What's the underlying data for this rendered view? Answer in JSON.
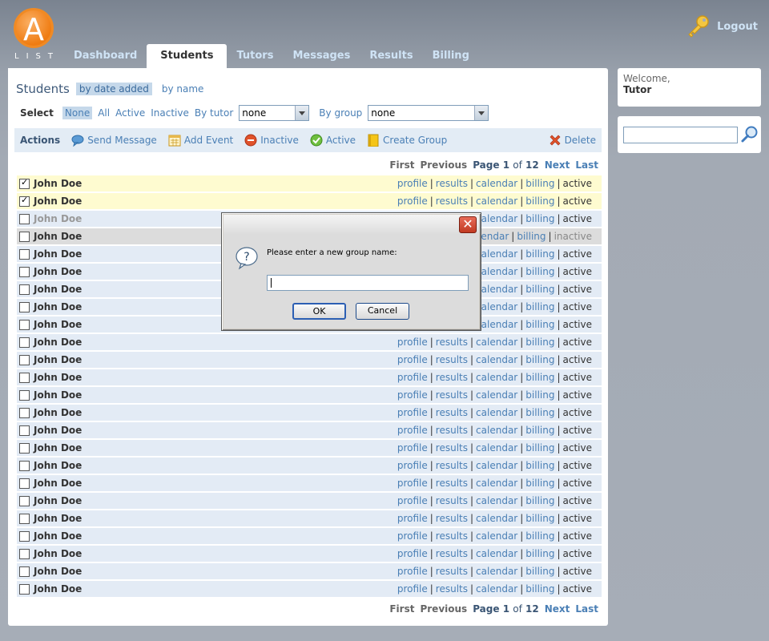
{
  "header": {
    "logo_letter": "A",
    "logo_text": "LIST",
    "logout_label": "Logout",
    "nav": [
      {
        "label": "Dashboard"
      },
      {
        "label": "Students"
      },
      {
        "label": "Tutors"
      },
      {
        "label": "Messages"
      },
      {
        "label": "Results"
      },
      {
        "label": "Billing"
      }
    ],
    "active_tab": "Students"
  },
  "main": {
    "title": "Students",
    "sort_active": "by date added",
    "sort_other": "by name",
    "select_label": "Select",
    "filters": [
      "None",
      "All",
      "Active",
      "Inactive"
    ],
    "by_tutor_label": "By tutor",
    "by_tutor_value": "none",
    "by_group_label": "By group",
    "by_group_value": "none",
    "actions_label": "Actions",
    "actions": {
      "send_message": "Send Message",
      "add_event": "Add Event",
      "inactive": "Inactive",
      "active": "Active",
      "create_group": "Create Group",
      "delete": "Delete"
    },
    "pager": {
      "first": "First",
      "previous": "Previous",
      "page_prefix": "Page",
      "page": "1",
      "of": "of",
      "total": "12",
      "next": "Next",
      "last": "Last"
    },
    "row_links": {
      "profile": "profile",
      "results": "results",
      "calendar": "calendar",
      "billing": "billing"
    },
    "students": [
      {
        "name": "John Doe",
        "checked": true,
        "status": "active",
        "dim": false
      },
      {
        "name": "John Doe",
        "checked": true,
        "status": "active",
        "dim": false
      },
      {
        "name": "John Doe",
        "checked": false,
        "status": "active",
        "dim": true
      },
      {
        "name": "John Doe",
        "checked": false,
        "status": "inactive",
        "dim": false
      },
      {
        "name": "John Doe",
        "checked": false,
        "status": "active",
        "dim": false
      },
      {
        "name": "John Doe",
        "checked": false,
        "status": "active",
        "dim": false
      },
      {
        "name": "John Doe",
        "checked": false,
        "status": "active",
        "dim": false
      },
      {
        "name": "John Doe",
        "checked": false,
        "status": "active",
        "dim": false
      },
      {
        "name": "John Doe",
        "checked": false,
        "status": "active",
        "dim": false
      },
      {
        "name": "John Doe",
        "checked": false,
        "status": "active",
        "dim": false
      },
      {
        "name": "John Doe",
        "checked": false,
        "status": "active",
        "dim": false
      },
      {
        "name": "John Doe",
        "checked": false,
        "status": "active",
        "dim": false
      },
      {
        "name": "John Doe",
        "checked": false,
        "status": "active",
        "dim": false
      },
      {
        "name": "John Doe",
        "checked": false,
        "status": "active",
        "dim": false
      },
      {
        "name": "John Doe",
        "checked": false,
        "status": "active",
        "dim": false
      },
      {
        "name": "John Doe",
        "checked": false,
        "status": "active",
        "dim": false
      },
      {
        "name": "John Doe",
        "checked": false,
        "status": "active",
        "dim": false
      },
      {
        "name": "John Doe",
        "checked": false,
        "status": "active",
        "dim": false
      },
      {
        "name": "John Doe",
        "checked": false,
        "status": "active",
        "dim": false
      },
      {
        "name": "John Doe",
        "checked": false,
        "status": "active",
        "dim": false
      },
      {
        "name": "John Doe",
        "checked": false,
        "status": "active",
        "dim": false
      },
      {
        "name": "John Doe",
        "checked": false,
        "status": "active",
        "dim": false
      },
      {
        "name": "John Doe",
        "checked": false,
        "status": "active",
        "dim": false
      },
      {
        "name": "John Doe",
        "checked": false,
        "status": "active",
        "dim": false
      }
    ]
  },
  "sidebar": {
    "welcome": "Welcome,",
    "user": "Tutor",
    "search_value": ""
  },
  "dialog": {
    "prompt": "Please enter a new group name:",
    "input_value": "",
    "ok_label": "OK",
    "cancel_label": "Cancel",
    "close_glyph": "✕"
  },
  "colors": {
    "link": "#4a7fb5",
    "checked_row": "#fefbd0",
    "row": "#e3ebf5",
    "inactive_row": "#dcdcdc",
    "logo": "#f08a24"
  }
}
